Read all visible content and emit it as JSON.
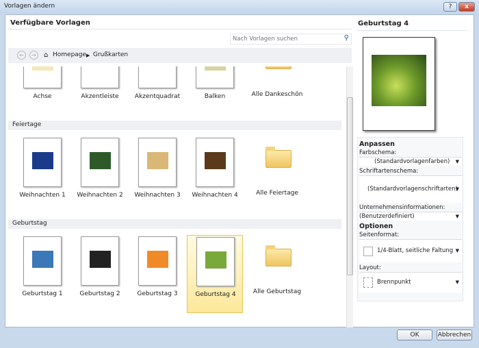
{
  "window": {
    "title": "Vorlagen ändern",
    "help": "?",
    "close": "x"
  },
  "left": {
    "heading": "Verfügbare Vorlagen",
    "search_placeholder": "Nach Vorlagen suchen",
    "breadcrumb": [
      "Homepage",
      "Grußkarten"
    ]
  },
  "sections": [
    {
      "name": "",
      "items": [
        "Achse",
        "Akzentleiste",
        "Akzentquadrat",
        "Balken"
      ],
      "folder": "Alle Dankeschön"
    },
    {
      "name": "Feiertage",
      "items": [
        "Weihnachten  1",
        "Weihnachten  2",
        "Weihnachten  3",
        "Weihnachten  4"
      ],
      "folder": "Alle Feiertage"
    },
    {
      "name": "Geburtstag",
      "items": [
        "Geburtstag  1",
        "Geburtstag  2",
        "Geburtstag  3",
        "Geburtstag  4"
      ],
      "folder": "Alle Geburtstag"
    }
  ],
  "selected": "Geburtstag  4",
  "right": {
    "title": "Geburtstag  4",
    "anpassen": "Anpassen",
    "farbschema_label": "Farbschema:",
    "farbschema": "(Standardvorlagenfarben)",
    "schrift_label": "Schriftartenschema:",
    "schrift": "(Standardvorlagenschriftarten)",
    "unternehmen_label": "Unternehmensinformationen:",
    "unternehmen": "(Benutzerdefiniert)",
    "optionen": "Optionen",
    "seitenformat_label": "Seitenformat:",
    "seitenformat": "1/4-Blatt, seitliche Faltung",
    "layout_label": "Layout:",
    "layout": "Brennpunkt"
  },
  "buttons": {
    "ok": "OK",
    "cancel": "Abbrechen"
  },
  "colors": {
    "selection": "#fde89a",
    "accent": "#2a5ea8"
  }
}
